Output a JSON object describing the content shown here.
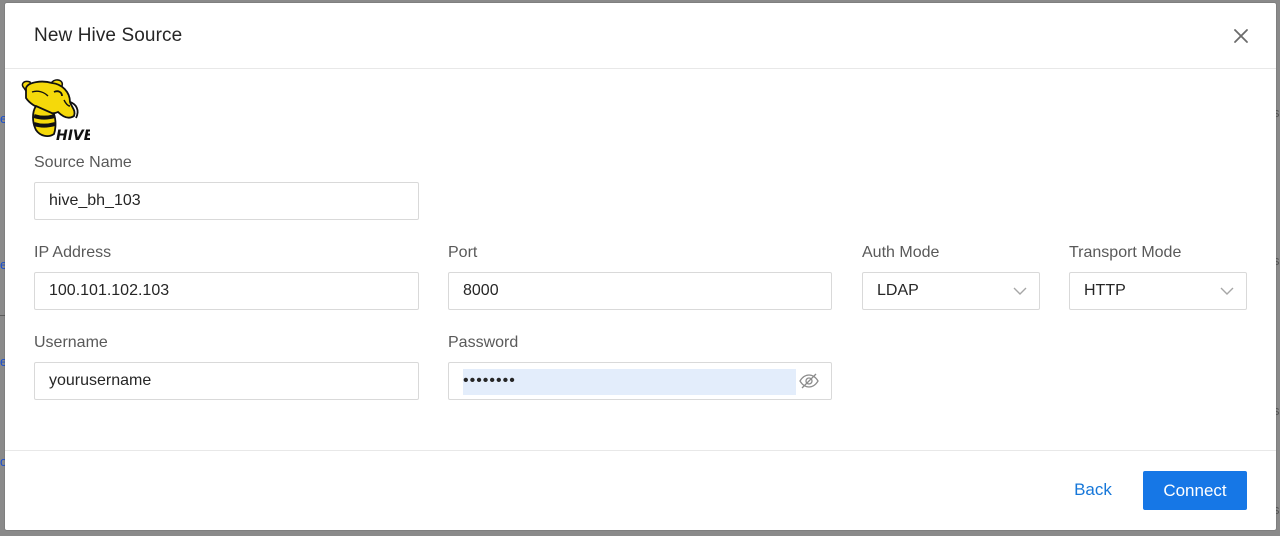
{
  "dialog": {
    "title": "New Hive Source",
    "close_icon": "close-icon",
    "logo": {
      "icon": "hive-logo",
      "text": "HIVE"
    }
  },
  "fields": {
    "source_name": {
      "label": "Source Name",
      "value": "hive_bh_103"
    },
    "ip_address": {
      "label": "IP Address",
      "value": "100.101.102.103"
    },
    "port": {
      "label": "Port",
      "value": "8000"
    },
    "auth_mode": {
      "label": "Auth Mode",
      "value": "LDAP"
    },
    "transport_mode": {
      "label": "Transport Mode",
      "value": "HTTP"
    },
    "username": {
      "label": "Username",
      "value": "yourusername"
    },
    "password": {
      "label": "Password",
      "value": "••••••••",
      "toggle_icon": "eye-off-icon"
    }
  },
  "footer": {
    "back_label": "Back",
    "connect_label": "Connect"
  },
  "colors": {
    "primary": "#1677e6",
    "link": "#1677d9",
    "autofill": "#e3edfb",
    "logo_yellow": "#f5d90a"
  }
}
